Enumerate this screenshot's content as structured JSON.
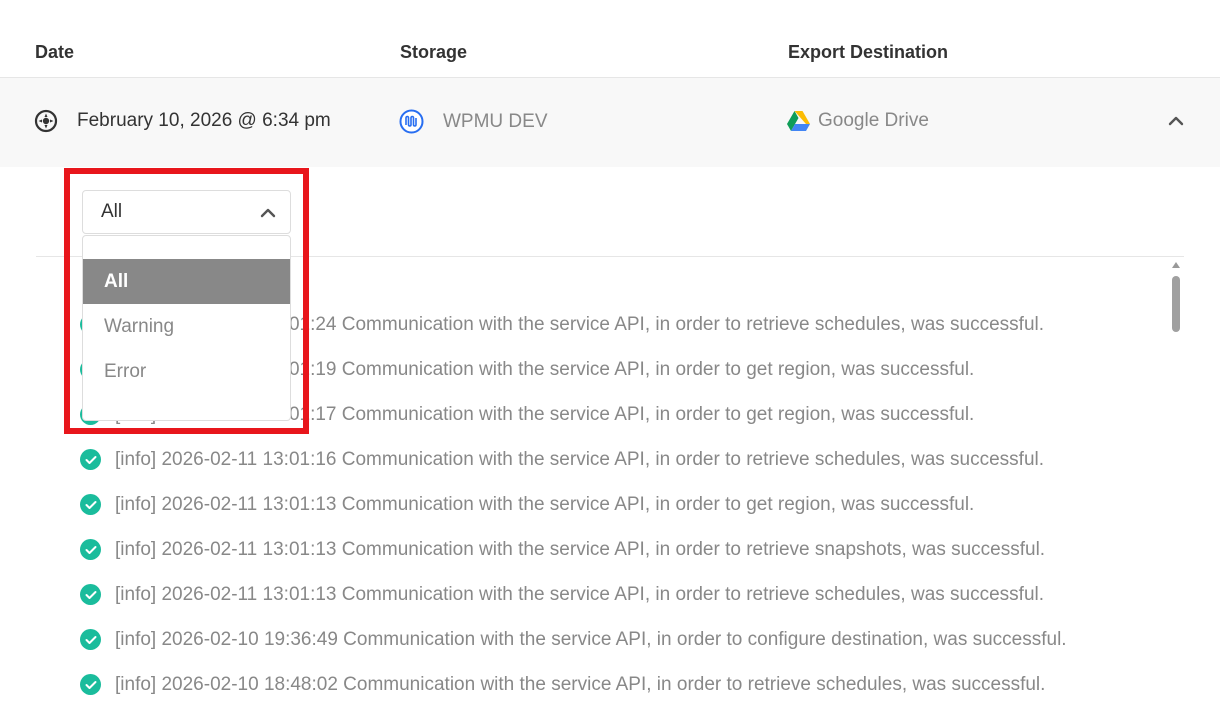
{
  "table": {
    "headers": {
      "date": "Date",
      "storage": "Storage",
      "export": "Export Destination"
    }
  },
  "backup": {
    "date": "February 10, 2026 @ 6:34 pm",
    "storage": "WPMU DEV",
    "destination": "Google Drive",
    "status_icon": "backup-status-icon",
    "toggle_icon": "chevron-up-icon"
  },
  "filter": {
    "selected": "All",
    "options": [
      "All",
      "Warning",
      "Error"
    ]
  },
  "logs": [
    "[info] 2026-02-11 13:01:24 Communication with the service API, in order to retrieve schedules, was successful.",
    "[info] 2026-02-11 13:01:19 Communication with the service API, in order to get region, was successful.",
    "[info] 2026-02-11 13:01:17 Communication with the service API, in order to get region, was successful.",
    "[info] 2026-02-11 13:01:16 Communication with the service API, in order to retrieve schedules, was successful.",
    "[info] 2026-02-11 13:01:13 Communication with the service API, in order to get region, was successful.",
    "[info] 2026-02-11 13:01:13 Communication with the service API, in order to retrieve snapshots, was successful.",
    "[info] 2026-02-11 13:01:13 Communication with the service API, in order to retrieve schedules, was successful.",
    "[info] 2026-02-10 19:36:49 Communication with the service API, in order to configure destination, was successful.",
    "[info] 2026-02-10 18:48:02 Communication with the service API, in order to retrieve schedules, was successful."
  ],
  "colors": {
    "success": "#1abc9c",
    "highlight": "#e8161c",
    "selected_option_bg": "#888888"
  }
}
